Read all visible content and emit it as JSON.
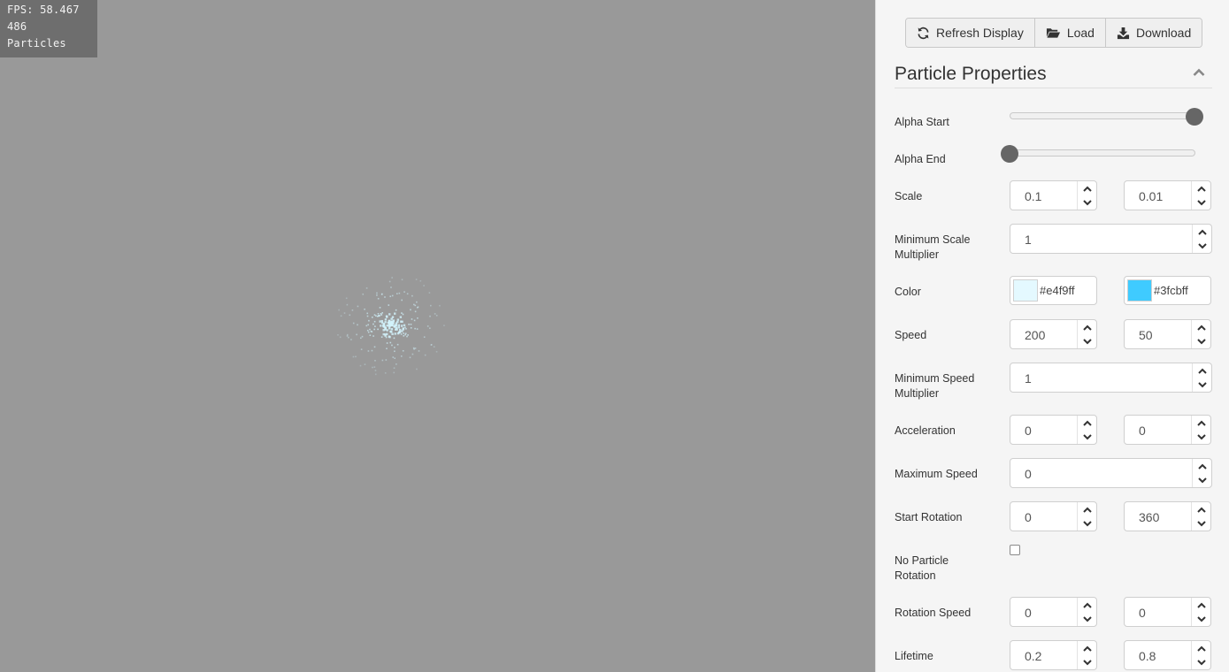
{
  "stats": {
    "fps_line": "FPS: 58.467",
    "count_line": "486",
    "particles_line": "Particles"
  },
  "toolbar": {
    "refresh_label": "Refresh Display",
    "load_label": "Load",
    "download_label": "Download"
  },
  "section": {
    "title": "Particle Properties"
  },
  "fields": {
    "alpha_start": {
      "label": "Alpha Start",
      "level": 1.0
    },
    "alpha_end": {
      "label": "Alpha End",
      "level": 0.0
    },
    "scale": {
      "label": "Scale",
      "start": "0.1",
      "end": "0.01"
    },
    "min_scale": {
      "label_1": "Minimum Scale",
      "label_2": "Multiplier",
      "value": "1"
    },
    "color": {
      "label": "Color",
      "start": "#e4f9ff",
      "end": "#3fcbff"
    },
    "speed": {
      "label": "Speed",
      "start": "200",
      "end": "50"
    },
    "min_speed": {
      "label_1": "Minimum Speed",
      "label_2": "Multiplier",
      "value": "1"
    },
    "acceleration": {
      "label": "Acceleration",
      "x": "0",
      "y": "0"
    },
    "max_speed": {
      "label": "Maximum Speed",
      "value": "0"
    },
    "start_rotation": {
      "label": "Start Rotation",
      "min": "0",
      "max": "360"
    },
    "no_rotation": {
      "label_1": "No Particle",
      "label_2": "Rotation",
      "checked": false
    },
    "rotation_speed": {
      "label": "Rotation Speed",
      "min": "0",
      "max": "0"
    },
    "lifetime": {
      "label": "Lifetime",
      "min": "0.2",
      "max": "0.8"
    }
  },
  "colors": {
    "canvas_bg": "#999999",
    "particle": "#d2f2fb",
    "panel_bg": "#f5f5f5"
  }
}
